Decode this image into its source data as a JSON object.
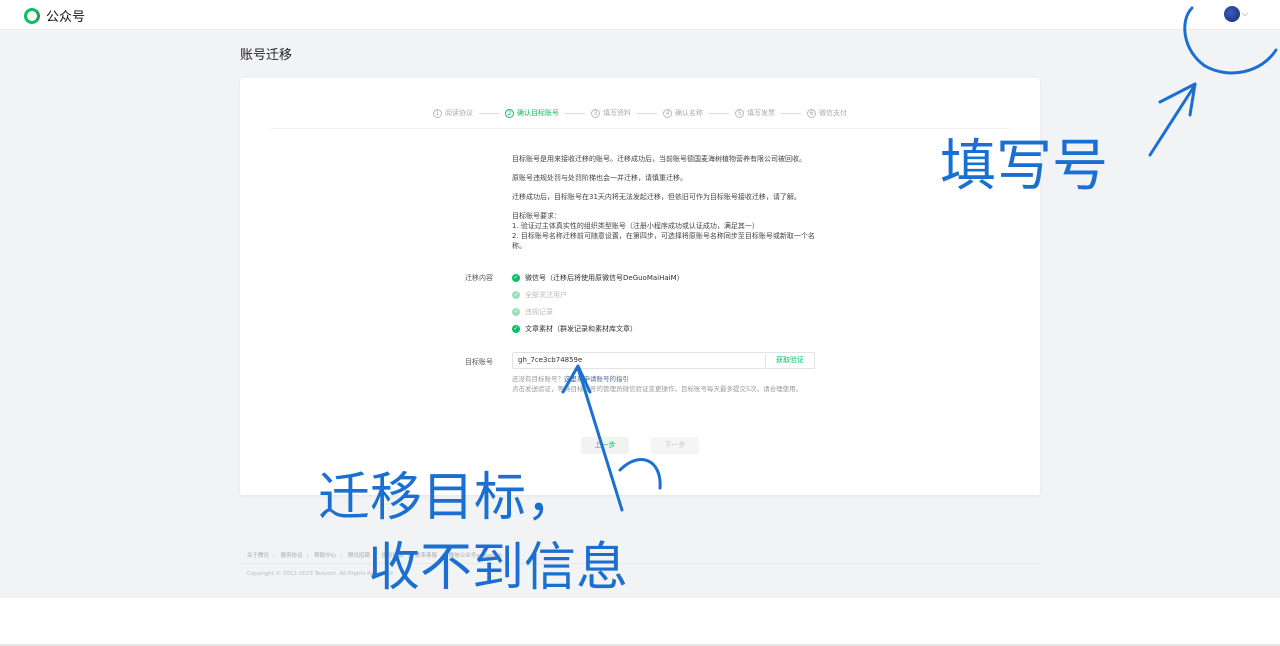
{
  "app": {
    "logo_text": "公众号"
  },
  "page_title": "账号迁移",
  "steps": [
    {
      "num": "1",
      "label": "阅读协议",
      "active": false
    },
    {
      "num": "2",
      "label": "确认目标账号",
      "active": true
    },
    {
      "num": "3",
      "label": "填写资料",
      "active": false
    },
    {
      "num": "4",
      "label": "确认名称",
      "active": false
    },
    {
      "num": "5",
      "label": "填写发票",
      "active": false
    },
    {
      "num": "6",
      "label": "微信支付",
      "active": false
    }
  ],
  "description": {
    "p1": "目标账号是用来接收迁移的账号。迁移成功后，当前账号德国麦海树植物营养有限公司被回收。",
    "p2": "原账号违规处罚与处罚阶梯也会一并迁移，请慎重迁移。",
    "p3": "迁移成功后，目标账号在31天内将无法发起迁移，但依旧可作为目标账号接收迁移，请了解。",
    "req_title": "目标账号要求：",
    "req1": "1. 验证过主体真实性的组织类型账号（注册小程序成功或认证成功，满足其一）",
    "req2": "2. 目标账号名称迁移前可随意设置，在第四步，可选择将原账号名称同步至目标账号或新取一个名称。"
  },
  "migrate": {
    "label": "迁移内容",
    "items": [
      {
        "text": "微信号（迁移后将使用原微信号DeGuoMaiHaiM）",
        "enabled": true
      },
      {
        "text": "全部关注用户",
        "enabled": false
      },
      {
        "text": "违规记录",
        "enabled": false
      },
      {
        "text": "文章素材（群发记录和素材库文章）",
        "enabled": true
      }
    ]
  },
  "target": {
    "label": "目标账号",
    "value": "gh_7ce3cb74859e",
    "verify_label": "获取验证"
  },
  "hint": {
    "line1_prefix": "还没有目标账号？",
    "line1_link": "这里有申请账号的指引",
    "line2": "点击发送验证，等待目标账号的管理员微信验证变更操作。目标账号每天最多提交5次，请合理使用。"
  },
  "buttons": {
    "prev": "上一步",
    "next": "下一步"
  },
  "footer": {
    "links": [
      "关于腾讯",
      "服务协议",
      "帮助中心",
      "腾讯招聘",
      "侵权投诉",
      "联系客服",
      "微信公众号wxlongsh"
    ],
    "copyright": "Copyright © 2012-2023 Tencent. All Rights Reserved."
  },
  "annotations": {
    "right": "填写号",
    "bottom_line1": "迁移目标，",
    "bottom_line2": "收不到信息"
  },
  "colors": {
    "accent": "#07c160",
    "ink": "#1a6fd1"
  }
}
